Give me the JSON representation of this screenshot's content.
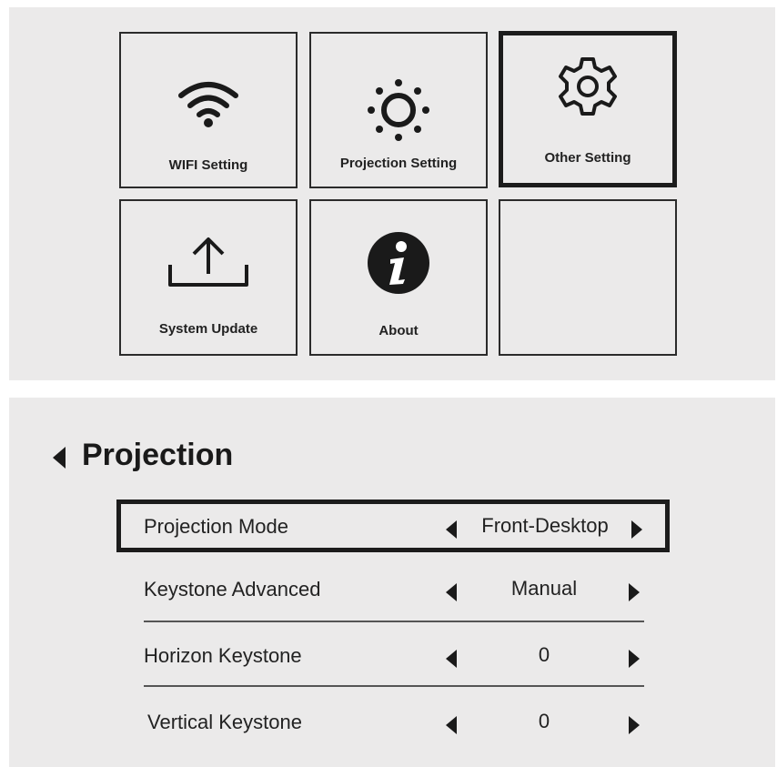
{
  "menu": {
    "tiles": [
      {
        "label": "WIFI Setting",
        "icon": "wifi-icon"
      },
      {
        "label": "Projection  Setting",
        "icon": "sun-icon"
      },
      {
        "label": "Other Setting",
        "icon": "gear-icon",
        "selected": true
      },
      {
        "label": "System Update",
        "icon": "upload-icon"
      },
      {
        "label": "About",
        "icon": "info-icon"
      },
      {
        "label": "",
        "icon": ""
      }
    ]
  },
  "projection": {
    "title": "Projection",
    "rows": [
      {
        "label": "Projection Mode",
        "value": "Front-Desktop",
        "selected": true
      },
      {
        "label": "Keystone Advanced",
        "value": "Manual"
      },
      {
        "label": "Horizon Keystone",
        "value": "0"
      },
      {
        "label": "Vertical Keystone",
        "value": "0"
      }
    ]
  },
  "colors": {
    "panel_bg": "#ebeaea",
    "border": "#1c1c1c"
  }
}
